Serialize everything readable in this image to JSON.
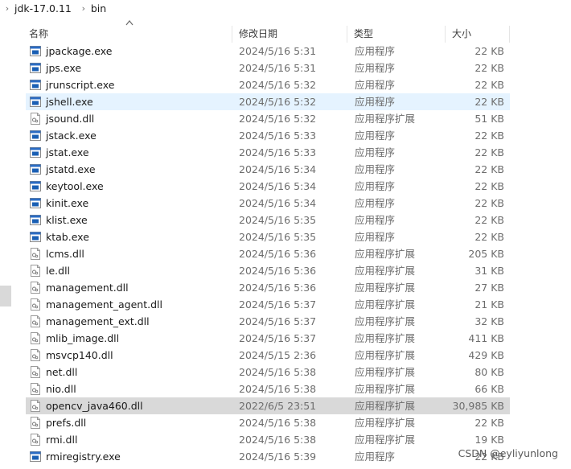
{
  "breadcrumb": {
    "items": [
      "jdk-17.0.11",
      "bin"
    ]
  },
  "columns": {
    "name": "名称",
    "date": "修改日期",
    "type": "类型",
    "size": "大小"
  },
  "files": [
    {
      "name": "jpackage.exe",
      "date": "2024/5/16 5:31",
      "type": "应用程序",
      "size": "22 KB",
      "icon": "exe"
    },
    {
      "name": "jps.exe",
      "date": "2024/5/16 5:31",
      "type": "应用程序",
      "size": "22 KB",
      "icon": "exe"
    },
    {
      "name": "jrunscript.exe",
      "date": "2024/5/16 5:32",
      "type": "应用程序",
      "size": "22 KB",
      "icon": "exe"
    },
    {
      "name": "jshell.exe",
      "date": "2024/5/16 5:32",
      "type": "应用程序",
      "size": "22 KB",
      "icon": "exe",
      "state": "hover"
    },
    {
      "name": "jsound.dll",
      "date": "2024/5/16 5:32",
      "type": "应用程序扩展",
      "size": "51 KB",
      "icon": "dll"
    },
    {
      "name": "jstack.exe",
      "date": "2024/5/16 5:33",
      "type": "应用程序",
      "size": "22 KB",
      "icon": "exe"
    },
    {
      "name": "jstat.exe",
      "date": "2024/5/16 5:33",
      "type": "应用程序",
      "size": "22 KB",
      "icon": "exe"
    },
    {
      "name": "jstatd.exe",
      "date": "2024/5/16 5:34",
      "type": "应用程序",
      "size": "22 KB",
      "icon": "exe"
    },
    {
      "name": "keytool.exe",
      "date": "2024/5/16 5:34",
      "type": "应用程序",
      "size": "22 KB",
      "icon": "exe"
    },
    {
      "name": "kinit.exe",
      "date": "2024/5/16 5:34",
      "type": "应用程序",
      "size": "22 KB",
      "icon": "exe"
    },
    {
      "name": "klist.exe",
      "date": "2024/5/16 5:35",
      "type": "应用程序",
      "size": "22 KB",
      "icon": "exe"
    },
    {
      "name": "ktab.exe",
      "date": "2024/5/16 5:35",
      "type": "应用程序",
      "size": "22 KB",
      "icon": "exe"
    },
    {
      "name": "lcms.dll",
      "date": "2024/5/16 5:36",
      "type": "应用程序扩展",
      "size": "205 KB",
      "icon": "dll"
    },
    {
      "name": "le.dll",
      "date": "2024/5/16 5:36",
      "type": "应用程序扩展",
      "size": "31 KB",
      "icon": "dll"
    },
    {
      "name": "management.dll",
      "date": "2024/5/16 5:36",
      "type": "应用程序扩展",
      "size": "27 KB",
      "icon": "dll"
    },
    {
      "name": "management_agent.dll",
      "date": "2024/5/16 5:37",
      "type": "应用程序扩展",
      "size": "21 KB",
      "icon": "dll"
    },
    {
      "name": "management_ext.dll",
      "date": "2024/5/16 5:37",
      "type": "应用程序扩展",
      "size": "32 KB",
      "icon": "dll"
    },
    {
      "name": "mlib_image.dll",
      "date": "2024/5/16 5:37",
      "type": "应用程序扩展",
      "size": "411 KB",
      "icon": "dll"
    },
    {
      "name": "msvcp140.dll",
      "date": "2024/5/15 2:36",
      "type": "应用程序扩展",
      "size": "429 KB",
      "icon": "dll"
    },
    {
      "name": "net.dll",
      "date": "2024/5/16 5:38",
      "type": "应用程序扩展",
      "size": "80 KB",
      "icon": "dll"
    },
    {
      "name": "nio.dll",
      "date": "2024/5/16 5:38",
      "type": "应用程序扩展",
      "size": "66 KB",
      "icon": "dll"
    },
    {
      "name": "opencv_java460.dll",
      "date": "2022/6/5 23:51",
      "type": "应用程序扩展",
      "size": "30,985 KB",
      "icon": "dll",
      "state": "selected"
    },
    {
      "name": "prefs.dll",
      "date": "2024/5/16 5:38",
      "type": "应用程序扩展",
      "size": "22 KB",
      "icon": "dll"
    },
    {
      "name": "rmi.dll",
      "date": "2024/5/16 5:38",
      "type": "应用程序扩展",
      "size": "19 KB",
      "icon": "dll"
    },
    {
      "name": "rmiregistry.exe",
      "date": "2024/5/16 5:39",
      "type": "应用程序",
      "size": "22 KB",
      "icon": "exe"
    }
  ],
  "watermark": "CSDN @eyliyunlong",
  "colors": {
    "hover": "#e5f3ff",
    "selected": "#d9d9d9",
    "exe_icon_blue": "#1a5fb4"
  }
}
